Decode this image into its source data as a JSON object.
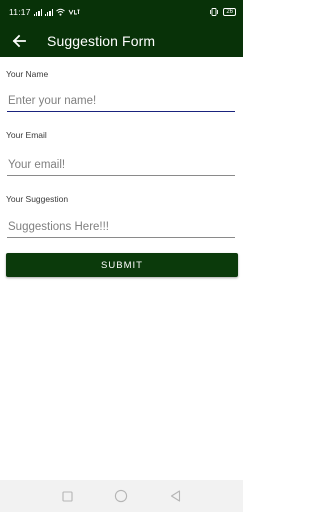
{
  "status_bar": {
    "time": "11:17",
    "battery": "26"
  },
  "app_bar": {
    "title": "Suggestion Form"
  },
  "form": {
    "fields": [
      {
        "label": "Your Name",
        "placeholder": "Enter your name!"
      },
      {
        "label": "Your Email",
        "placeholder": "Your email!"
      },
      {
        "label": "Your Suggestion",
        "placeholder": "Suggestions Here!!!"
      }
    ],
    "submit_label": "SUBMIT"
  },
  "colors": {
    "app_bar": "#083208",
    "button": "#0b3a0b",
    "active_underline": "#1a237e"
  },
  "icons": {
    "back": "arrow-left-icon",
    "nav": [
      "square-icon",
      "circle-icon",
      "triangle-back-icon"
    ]
  }
}
